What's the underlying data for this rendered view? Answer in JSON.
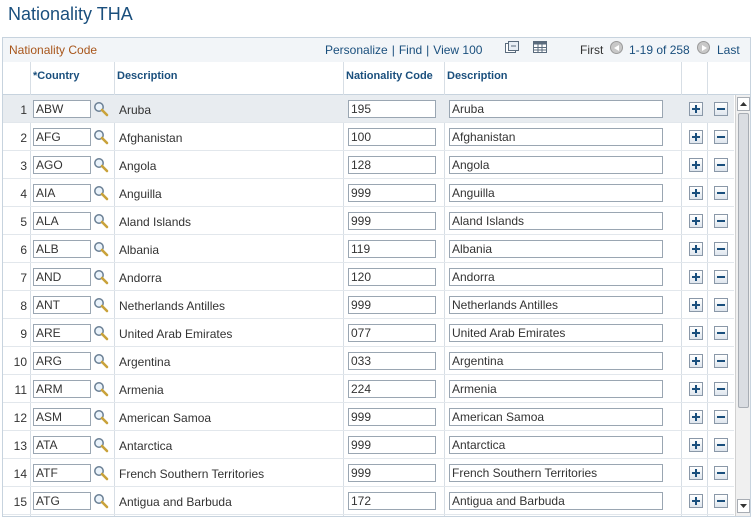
{
  "page": {
    "title": "Nationality THA"
  },
  "grid": {
    "title": "Nationality Code",
    "nav": {
      "personalize": "Personalize",
      "find": "Find",
      "view": "View 100",
      "sep": "|"
    },
    "pager": {
      "first": "First",
      "count": "1-19 of 258",
      "last": "Last"
    },
    "columns": {
      "country": "*Country",
      "description": "Description",
      "nationality_code": "Nationality Code",
      "description2": "Description"
    },
    "rows": [
      {
        "num": "1",
        "country": "ABW",
        "desc": "Aruba",
        "code": "195",
        "desc2": "Aruba"
      },
      {
        "num": "2",
        "country": "AFG",
        "desc": "Afghanistan",
        "code": "100",
        "desc2": "Afghanistan"
      },
      {
        "num": "3",
        "country": "AGO",
        "desc": "Angola",
        "code": "128",
        "desc2": "Angola"
      },
      {
        "num": "4",
        "country": "AIA",
        "desc": "Anguilla",
        "code": "999",
        "desc2": "Anguilla"
      },
      {
        "num": "5",
        "country": "ALA",
        "desc": "Aland Islands",
        "code": "999",
        "desc2": "Aland Islands"
      },
      {
        "num": "6",
        "country": "ALB",
        "desc": "Albania",
        "code": "119",
        "desc2": "Albania"
      },
      {
        "num": "7",
        "country": "AND",
        "desc": "Andorra",
        "code": "120",
        "desc2": "Andorra"
      },
      {
        "num": "8",
        "country": "ANT",
        "desc": "Netherlands Antilles",
        "code": "999",
        "desc2": "Netherlands Antilles"
      },
      {
        "num": "9",
        "country": "ARE",
        "desc": "United Arab Emirates",
        "code": "077",
        "desc2": "United Arab Emirates"
      },
      {
        "num": "10",
        "country": "ARG",
        "desc": "Argentina",
        "code": "033",
        "desc2": "Argentina"
      },
      {
        "num": "11",
        "country": "ARM",
        "desc": "Armenia",
        "code": "224",
        "desc2": "Armenia"
      },
      {
        "num": "12",
        "country": "ASM",
        "desc": "American Samoa",
        "code": "999",
        "desc2": "American Samoa"
      },
      {
        "num": "13",
        "country": "ATA",
        "desc": "Antarctica",
        "code": "999",
        "desc2": "Antarctica"
      },
      {
        "num": "14",
        "country": "ATF",
        "desc": "French Southern Territories",
        "code": "999",
        "desc2": "French Southern Territories"
      },
      {
        "num": "15",
        "country": "ATG",
        "desc": "Antigua and Barbuda",
        "code": "172",
        "desc2": "Antigua and Barbuda"
      }
    ]
  },
  "icons": {
    "lookup": "magnifier-icon",
    "zoom": "zoom-grid-icon",
    "download": "spreadsheet-icon",
    "add": "plus-icon",
    "delete": "minus-icon"
  },
  "colors": {
    "title": "#1a4f7d",
    "grid_title": "#a8561b",
    "link": "#1a4f7d"
  }
}
